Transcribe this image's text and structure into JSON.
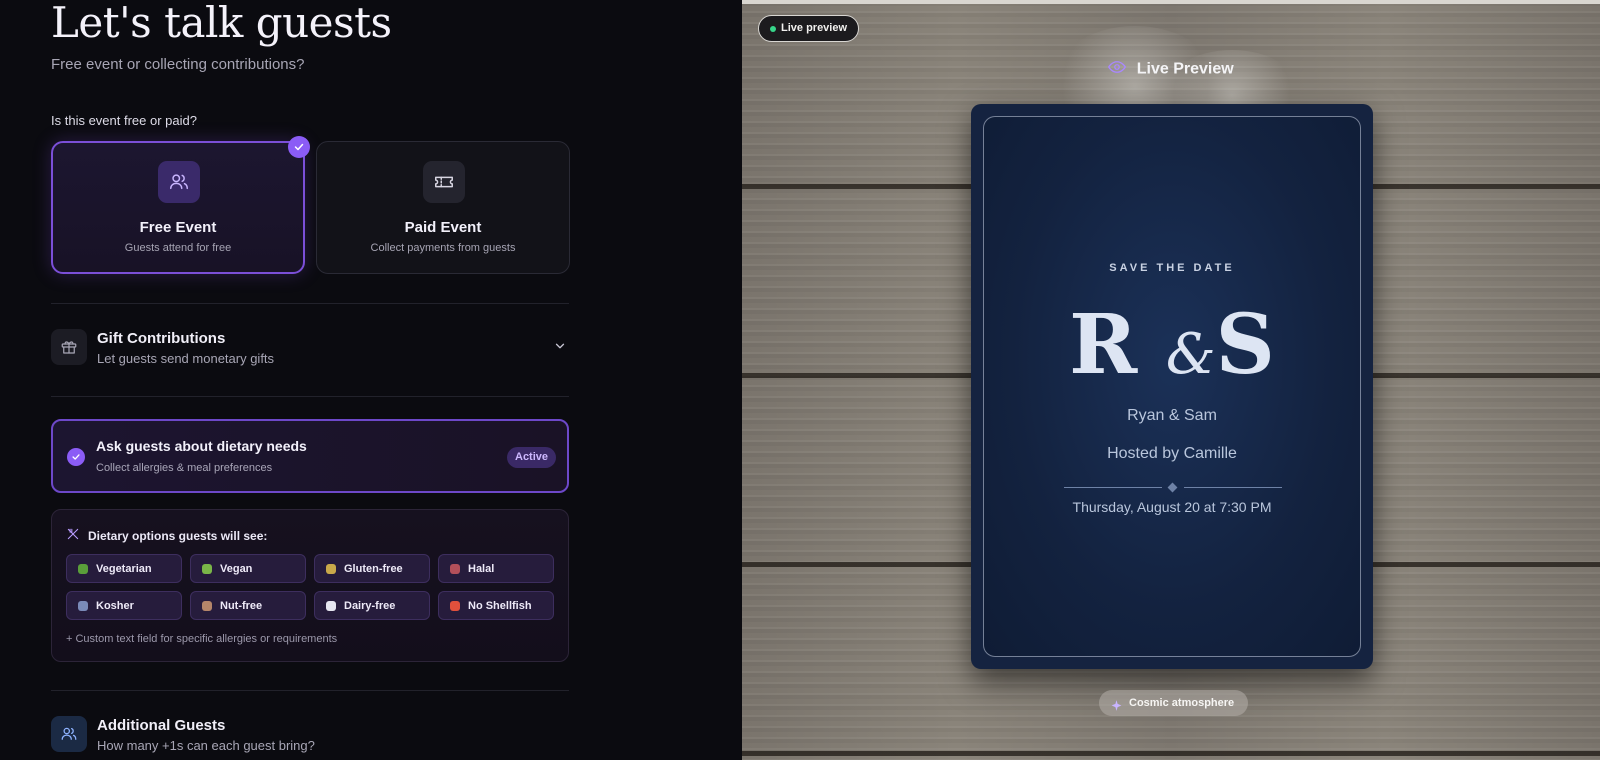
{
  "header": {
    "title": "Let's talk guests",
    "subtitle": "Free event or collecting contributions?"
  },
  "pricing": {
    "question": "Is this event free or paid?",
    "options": [
      {
        "title": "Free Event",
        "description": "Guests attend for free",
        "selected": true,
        "icon": "users-icon"
      },
      {
        "title": "Paid Event",
        "description": "Collect payments from guests",
        "selected": false,
        "icon": "ticket-icon"
      }
    ]
  },
  "gift": {
    "title": "Gift Contributions",
    "description": "Let guests send monetary gifts",
    "icon": "gift-icon"
  },
  "dietary": {
    "title": "Ask guests about dietary needs",
    "description": "Collect allergies & meal preferences",
    "status": "Active",
    "options_heading": "Dietary options guests will see:",
    "options": [
      {
        "label": "Vegetarian",
        "color": "#5a9e3a"
      },
      {
        "label": "Vegan",
        "color": "#7ab648"
      },
      {
        "label": "Gluten-free",
        "color": "#c9a94a"
      },
      {
        "label": "Halal",
        "color": "#b3505a"
      },
      {
        "label": "Kosher",
        "color": "#7a8ab8"
      },
      {
        "label": "Nut-free",
        "color": "#b5866a"
      },
      {
        "label": "Dairy-free",
        "color": "#e6e6f0"
      },
      {
        "label": "No Shellfish",
        "color": "#e0503c"
      }
    ],
    "note": "+ Custom text field for specific allergies or requirements"
  },
  "additional": {
    "title": "Additional Guests",
    "description": "How many +1s can each guest bring?"
  },
  "preview": {
    "chip_label": "Live preview",
    "title": "Live Preview",
    "card": {
      "kicker": "SAVE THE DATE",
      "monogram_left": "R",
      "monogram_amp": "&",
      "monogram_right": "S",
      "names": "Ryan & Sam",
      "host": "Hosted by Camille",
      "date": "Thursday, August 20 at 7:30 PM"
    },
    "atmosphere": "Cosmic atmosphere"
  },
  "colors": {
    "accent": "#8b5cf6",
    "card_navy": "#13223f"
  }
}
